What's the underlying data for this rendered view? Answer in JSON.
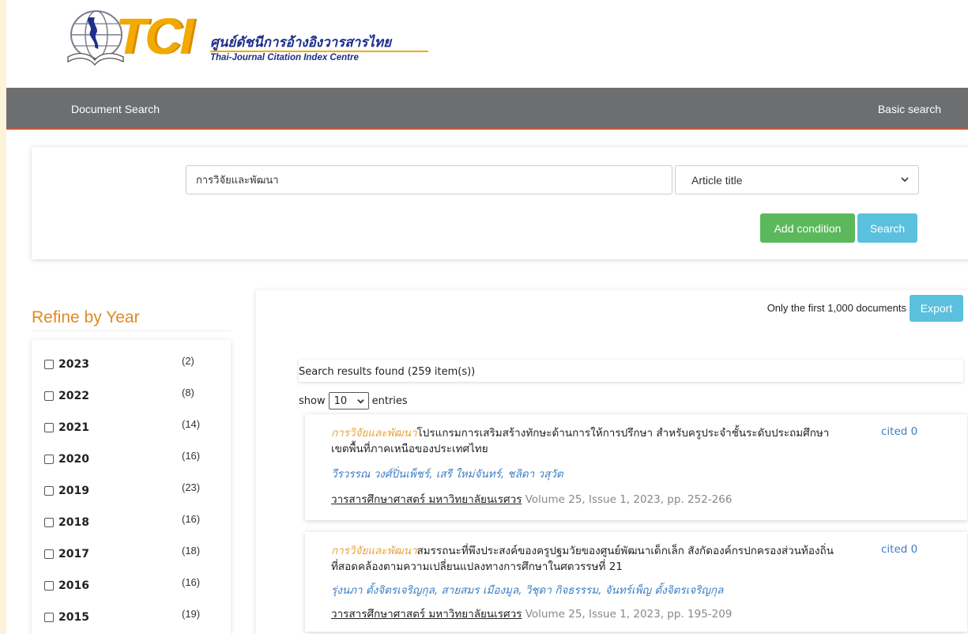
{
  "header": {
    "logo_text": "TCI",
    "org_name_th": "ศูนย์ดัชนีการอ้างอิงวารสารไทย",
    "org_name_en": "Thai-Journal Citation Index Centre"
  },
  "nav": {
    "left_link": "Document Search",
    "right_link": "Basic search"
  },
  "search": {
    "query_value": "การวิจัยและพัฒนา",
    "field_selected": "Article title",
    "add_condition_label": "Add condition",
    "search_label": "Search"
  },
  "refine": {
    "title": "Refine by Year",
    "years": [
      {
        "year": "2023",
        "count": "(2)"
      },
      {
        "year": "2022",
        "count": "(8)"
      },
      {
        "year": "2021",
        "count": "(14)"
      },
      {
        "year": "2020",
        "count": "(16)"
      },
      {
        "year": "2019",
        "count": "(23)"
      },
      {
        "year": "2018",
        "count": "(16)"
      },
      {
        "year": "2017",
        "count": "(18)"
      },
      {
        "year": "2016",
        "count": "(16)"
      },
      {
        "year": "2015",
        "count": "(19)"
      }
    ]
  },
  "results": {
    "only_first_note": "Only the first 1,000 documents",
    "export_label": "Export",
    "found_text": "Search results found (259 item(s))",
    "show_label": "show",
    "entries_value": "10",
    "entries_label": "entries",
    "items": [
      {
        "title_highlight": "การวิจัยและพัฒนา",
        "title_rest": "โปรแกรมการเสริมสร้างทักษะด้านการให้การปรึกษา สำหรับครูประจำชั้นระดับประถมศึกษา เขตพื้นที่ภาคเหนือของประเทศไทย",
        "cited": "cited 0",
        "authors": "วีรวรรณ วงศ์ปิ่นเพ็ชร์, เสรี ใหม่จันทร์, ชลิดา วสุวัต",
        "journal": "วารสารศึกษาศาสตร์ มหาวิทยาลัยนเรศวร",
        "details": " Volume 25, Issue 1, 2023, pp. 252-266"
      },
      {
        "title_highlight": "การวิจัยและพัฒนา",
        "title_rest": "สมรรถนะที่พึงประสงค์ของครูปฐมวัยของศูนย์พัฒนาเด็กเล็ก สังกัดองค์กรปกครองส่วนท้องถิ่น ที่สอดคล้องตามความเปลี่ยนแปลงทางการศึกษาในศตวรรษที่ 21",
        "cited": "cited 0",
        "authors": "รุ่งนภา ตั้งจิตรเจริญกุล, สายสมร เมืองมูล, วิชุดา กิจธรรรม, จันทร์เพ็ญ ตั้งจิตรเจริญกุล",
        "journal": "วารสารศึกษาศาสตร์ มหาวิทยาลัยนเรศวร",
        "details": " Volume 25, Issue 1, 2023, pp. 195-209"
      }
    ]
  },
  "colors": {
    "navbar": "#6d6e70",
    "add_button": "#5cb85c",
    "search_button": "#5bc0de",
    "refine_title": "#e08a20",
    "highlight": "#e8a33c",
    "link_blue": "#3b7ec4"
  }
}
